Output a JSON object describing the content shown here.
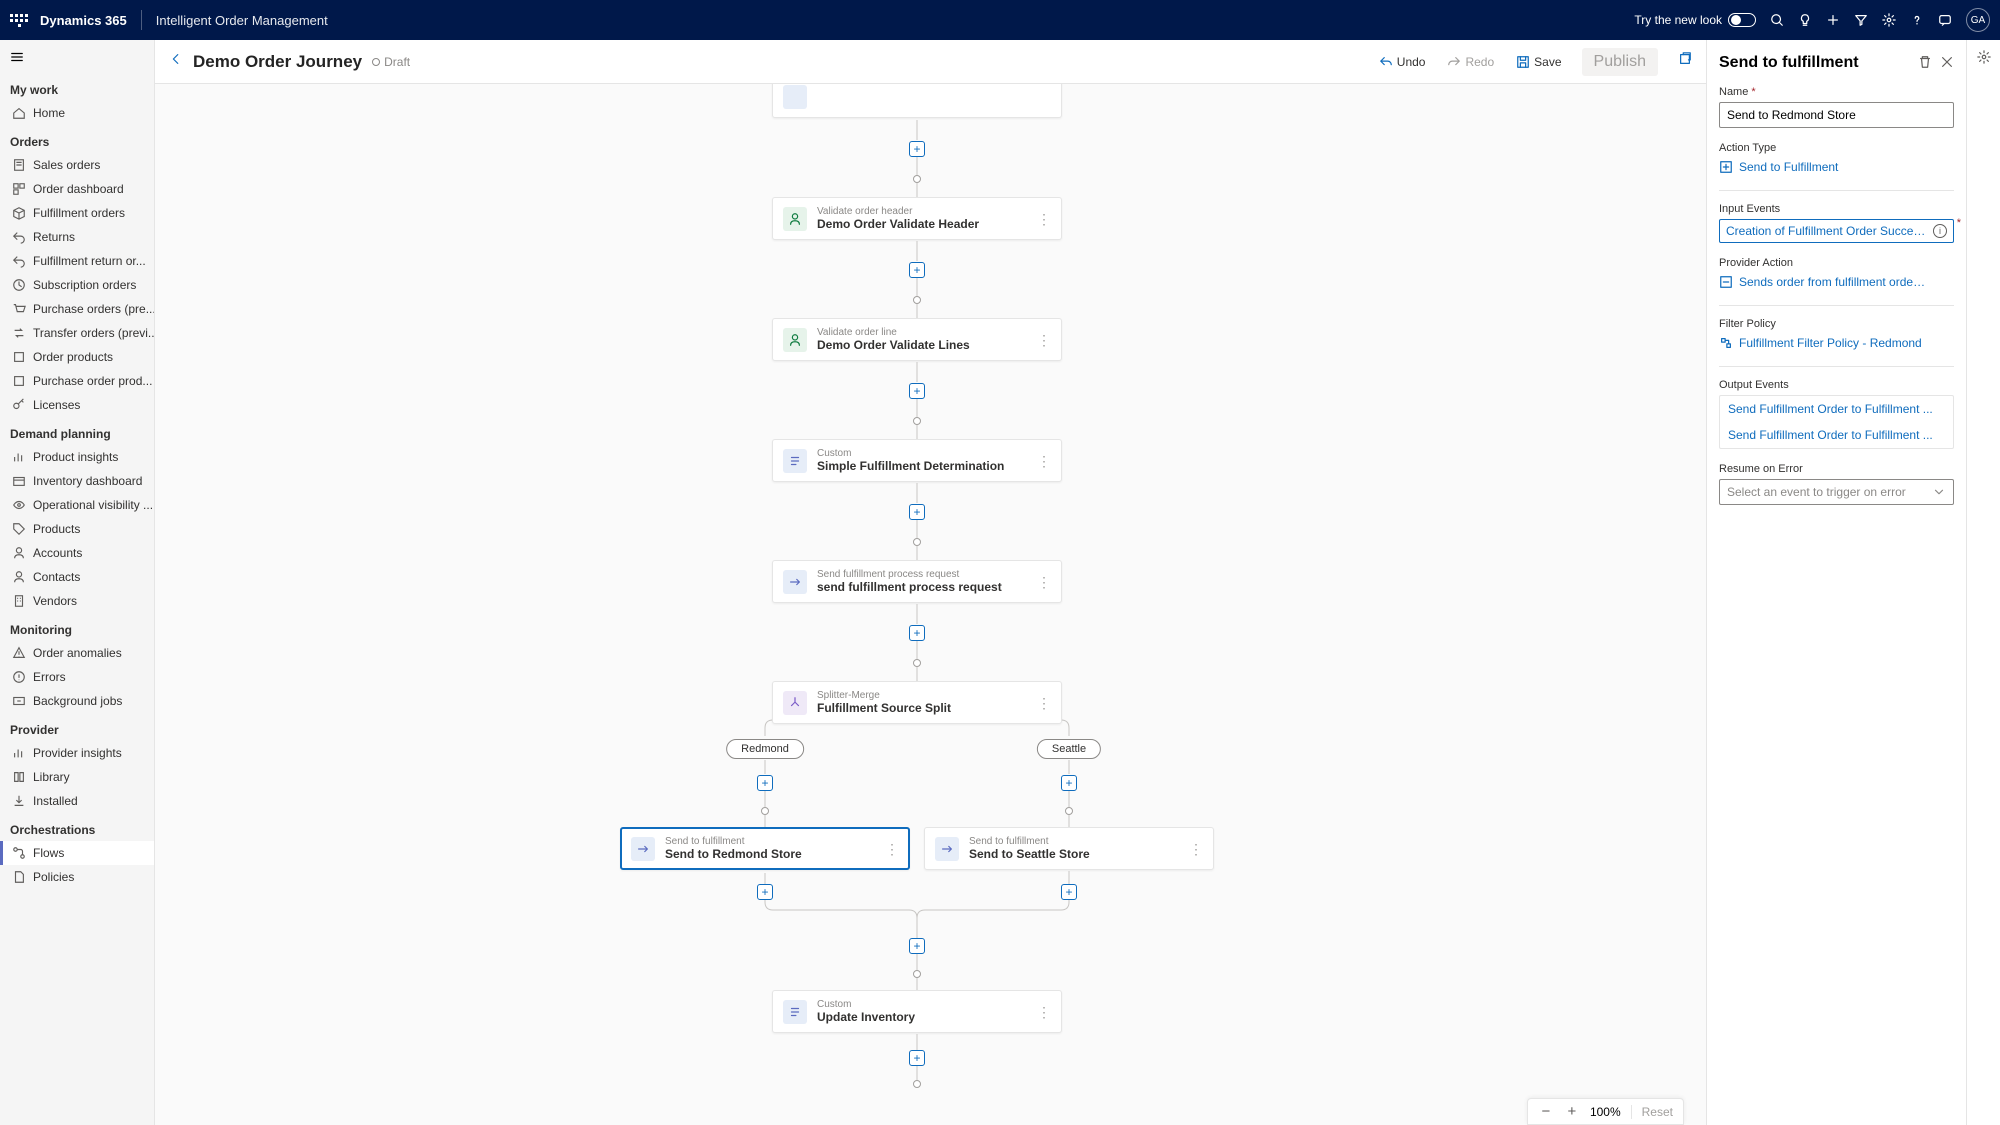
{
  "topbar": {
    "brand": "Dynamics 365",
    "app": "Intelligent Order Management",
    "tryNew": "Try the new look",
    "avatar": "GA"
  },
  "sidebar": {
    "groups": [
      {
        "header": "My work",
        "items": [
          {
            "label": "Home"
          }
        ]
      },
      {
        "header": "Orders",
        "items": [
          {
            "label": "Sales orders"
          },
          {
            "label": "Order dashboard"
          },
          {
            "label": "Fulfillment orders"
          },
          {
            "label": "Returns"
          },
          {
            "label": "Fulfillment return or..."
          },
          {
            "label": "Subscription orders"
          },
          {
            "label": "Purchase orders (pre..."
          },
          {
            "label": "Transfer orders (previ..."
          },
          {
            "label": "Order products"
          },
          {
            "label": "Purchase order prod..."
          },
          {
            "label": "Licenses"
          }
        ]
      },
      {
        "header": "Demand planning",
        "items": [
          {
            "label": "Product insights"
          },
          {
            "label": "Inventory dashboard"
          },
          {
            "label": "Operational visibility ..."
          },
          {
            "label": "Products"
          },
          {
            "label": "Accounts"
          },
          {
            "label": "Contacts"
          },
          {
            "label": "Vendors"
          }
        ]
      },
      {
        "header": "Monitoring",
        "items": [
          {
            "label": "Order anomalies"
          },
          {
            "label": "Errors"
          },
          {
            "label": "Background jobs"
          }
        ]
      },
      {
        "header": "Provider",
        "items": [
          {
            "label": "Provider insights"
          },
          {
            "label": "Library"
          },
          {
            "label": "Installed"
          }
        ]
      },
      {
        "header": "Orchestrations",
        "items": [
          {
            "label": "Flows",
            "active": true
          },
          {
            "label": "Policies"
          }
        ]
      }
    ]
  },
  "cmdbar": {
    "title": "Demo Order Journey",
    "status": "Draft",
    "undo": "Undo",
    "redo": "Redo",
    "save": "Save",
    "publish": "Publish"
  },
  "flow": {
    "nodes": [
      {
        "type": "Validate order header",
        "name": "Demo Order Validate Header",
        "tile": "green"
      },
      {
        "type": "Validate order line",
        "name": "Demo Order Validate Lines",
        "tile": "green"
      },
      {
        "type": "Custom",
        "name": "Simple Fulfillment Determination",
        "tile": "blue"
      },
      {
        "type": "Send fulfillment process request",
        "name": "send fulfillment process request",
        "tile": "blue"
      },
      {
        "type": "Splitter-Merge",
        "name": "Fulfillment Source Split",
        "tile": "purple"
      },
      {
        "type": "Custom",
        "name": "Update Inventory",
        "tile": "blue"
      }
    ],
    "branches": {
      "left": {
        "label": "Redmond",
        "node": {
          "type": "Send to fulfillment",
          "name": "Send to Redmond Store",
          "tile": "blue",
          "selected": true
        }
      },
      "right": {
        "label": "Seattle",
        "node": {
          "type": "Send to fulfillment",
          "name": "Send to Seattle Store",
          "tile": "blue"
        }
      }
    }
  },
  "zoom": {
    "level": "100%",
    "reset": "Reset"
  },
  "panel": {
    "title": "Send to fulfillment",
    "name": {
      "label": "Name",
      "value": "Send to Redmond Store"
    },
    "actionType": {
      "label": "Action Type",
      "value": "Send to Fulfillment"
    },
    "inputEvents": {
      "label": "Input Events",
      "tag": "Creation of Fulfillment Order Succeed..."
    },
    "providerAction": {
      "label": "Provider Action",
      "value": "Sends order from fulfillment order to de..."
    },
    "filterPolicy": {
      "label": "Filter Policy",
      "value": "Fulfillment Filter Policy - Redmond"
    },
    "outputEvents": {
      "label": "Output Events",
      "items": [
        "Send Fulfillment Order to Fulfillment ...",
        "Send Fulfillment Order to Fulfillment ..."
      ]
    },
    "resumeOnError": {
      "label": "Resume on Error",
      "placeholder": "Select an event to trigger on error"
    }
  }
}
